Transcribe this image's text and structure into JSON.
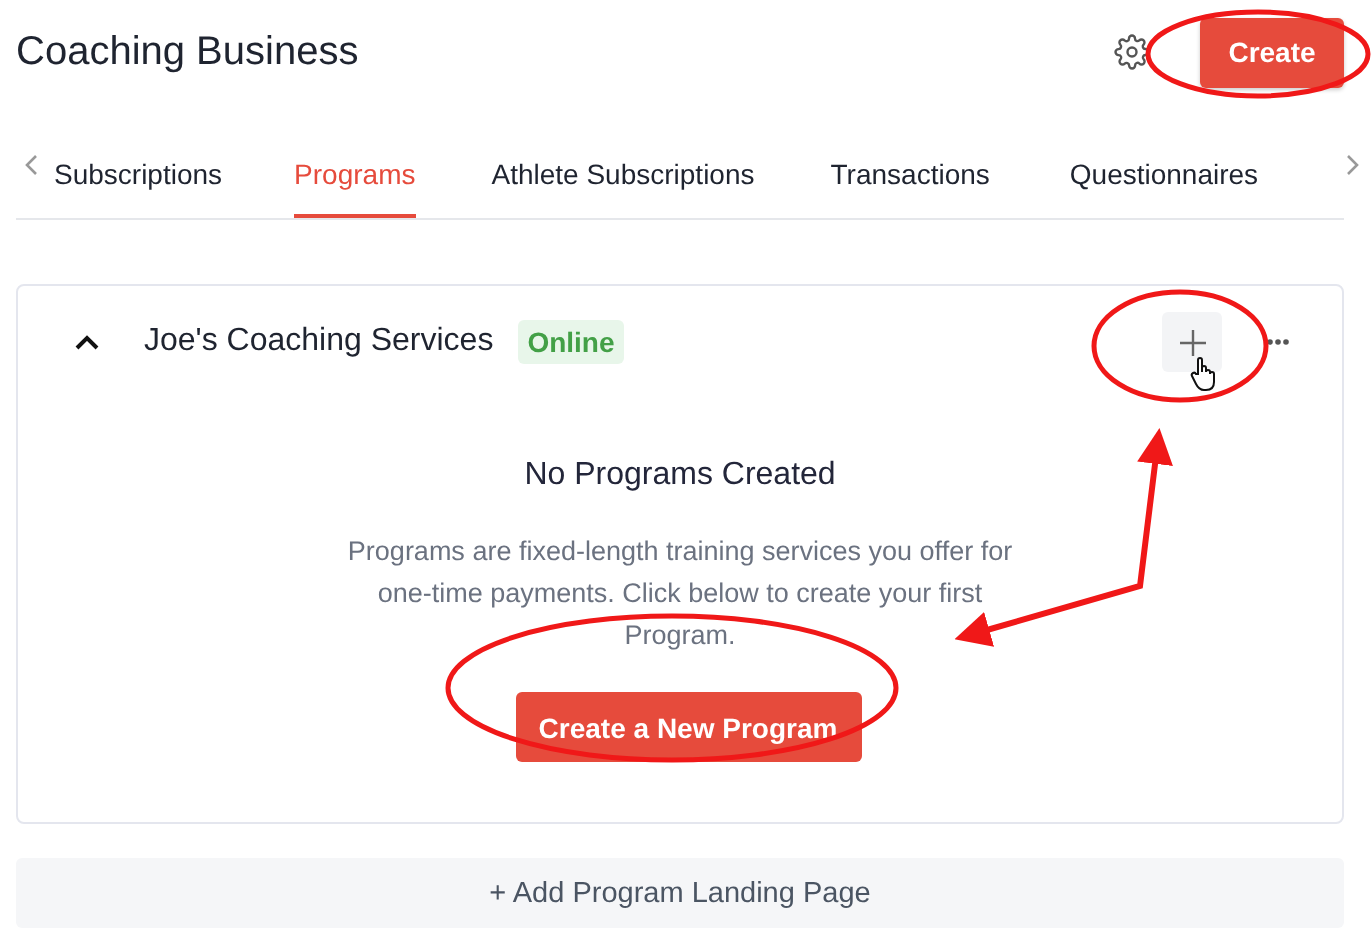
{
  "page": {
    "title": "Coaching Business"
  },
  "create_button": "Create",
  "tabs": [
    {
      "label": "Subscriptions",
      "selected": false
    },
    {
      "label": "Programs",
      "selected": true
    },
    {
      "label": "Athlete Subscriptions",
      "selected": false
    },
    {
      "label": "Transactions",
      "selected": false
    },
    {
      "label": "Questionnaires",
      "selected": false
    }
  ],
  "card": {
    "name": "Joe's Coaching Services",
    "status": "Online",
    "expanded": true,
    "empty_state": {
      "heading": "No Programs Created",
      "description": "Programs are fixed-length training services you offer for one-time payments. Click below to create your first Program.",
      "button": "Create a New Program"
    }
  },
  "add_landing_page": "+ Add Program Landing Page"
}
